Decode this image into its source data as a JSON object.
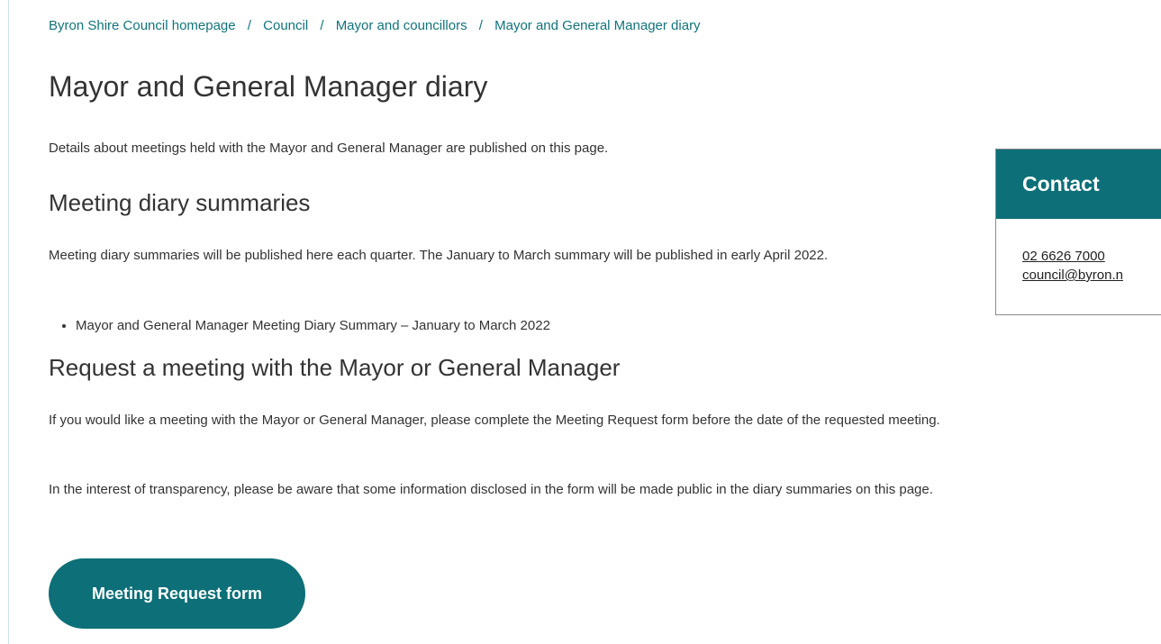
{
  "breadcrumb": {
    "items": [
      {
        "label": "Byron Shire Council homepage"
      },
      {
        "label": "Council"
      },
      {
        "label": "Mayor and councillors"
      },
      {
        "label": "Mayor and General Manager diary"
      }
    ],
    "separator": "/"
  },
  "page": {
    "title": "Mayor and General Manager diary",
    "intro": "Details about meetings held with the Mayor and General Manager are published on this page."
  },
  "summaries": {
    "heading": "Meeting diary summaries",
    "text": "Meeting diary summaries will be published here each quarter.  The January to March summary will be published in early April 2022.",
    "items": [
      {
        "label": "Mayor and General Manager Meeting Diary Summary – January to March 2022"
      }
    ]
  },
  "request": {
    "heading": "Request a meeting with the Mayor or General Manager",
    "text1": "If you would like a meeting with the Mayor or General Manager, please complete the Meeting Request form before the date of the requested meeting.",
    "text2": "In the interest of transparency, please be aware that some information disclosed in the form will be made public in the diary summaries on this page.",
    "button_label": "Meeting Request form"
  },
  "contact": {
    "heading": "Contact",
    "phone": "02 6626 7000",
    "email": "council@byron.n"
  },
  "colors": {
    "accent": "#0d6f77",
    "link": "#11737b"
  }
}
